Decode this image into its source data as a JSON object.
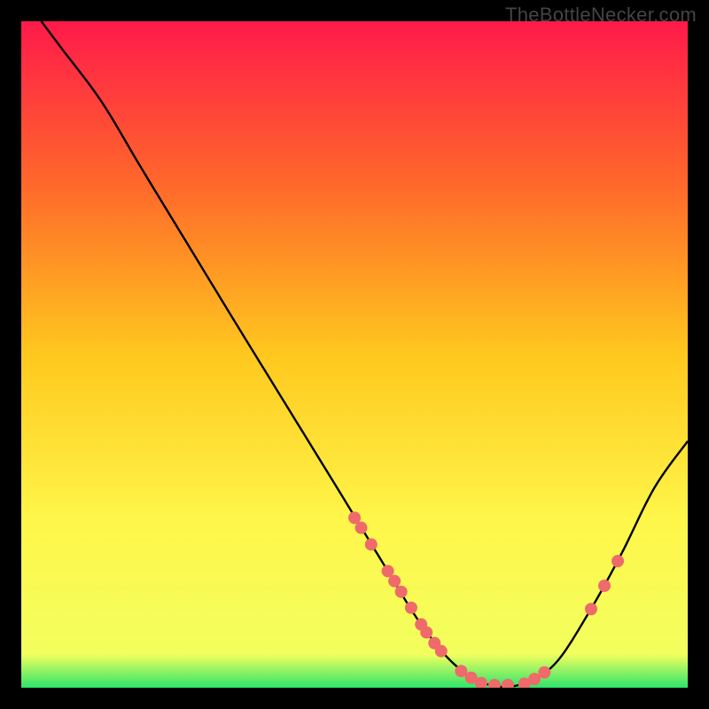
{
  "watermark": "TheBottleNecker.com",
  "chart_data": {
    "type": "line",
    "title": "",
    "xlabel": "",
    "ylabel": "",
    "xlim": [
      0,
      100
    ],
    "ylim": [
      0,
      100
    ],
    "grid": false,
    "background_gradient": {
      "stops": [
        {
          "offset": 0,
          "color": "#ff1a4a"
        },
        {
          "offset": 25,
          "color": "#ff6a2a"
        },
        {
          "offset": 50,
          "color": "#ffc81e"
        },
        {
          "offset": 75,
          "color": "#fff64a"
        },
        {
          "offset": 95,
          "color": "#f2ff5e"
        },
        {
          "offset": 100,
          "color": "#2ee56b"
        }
      ]
    },
    "curve": [
      {
        "x": 3.0,
        "y": 100.0
      },
      {
        "x": 6.0,
        "y": 96.0
      },
      {
        "x": 12.0,
        "y": 88.0
      },
      {
        "x": 18.0,
        "y": 78.0
      },
      {
        "x": 25.0,
        "y": 66.5
      },
      {
        "x": 32.0,
        "y": 55.0
      },
      {
        "x": 40.0,
        "y": 42.0
      },
      {
        "x": 48.0,
        "y": 29.0
      },
      {
        "x": 55.0,
        "y": 17.5
      },
      {
        "x": 60.0,
        "y": 9.5
      },
      {
        "x": 65.0,
        "y": 3.5
      },
      {
        "x": 70.0,
        "y": 0.5
      },
      {
        "x": 75.0,
        "y": 0.5
      },
      {
        "x": 80.0,
        "y": 3.5
      },
      {
        "x": 85.0,
        "y": 11.0
      },
      {
        "x": 90.0,
        "y": 20.0
      },
      {
        "x": 95.0,
        "y": 30.0
      },
      {
        "x": 100.0,
        "y": 37.0
      }
    ],
    "marker_points": [
      {
        "x": 50.0,
        "y": 25.5
      },
      {
        "x": 51.0,
        "y": 24.0
      },
      {
        "x": 52.5,
        "y": 21.5
      },
      {
        "x": 55.0,
        "y": 17.5
      },
      {
        "x": 56.0,
        "y": 16.0
      },
      {
        "x": 57.0,
        "y": 14.4
      },
      {
        "x": 58.5,
        "y": 12.0
      },
      {
        "x": 60.0,
        "y": 9.5
      },
      {
        "x": 60.8,
        "y": 8.3
      },
      {
        "x": 62.0,
        "y": 6.7
      },
      {
        "x": 63.0,
        "y": 5.5
      },
      {
        "x": 66.0,
        "y": 2.5
      },
      {
        "x": 67.5,
        "y": 1.5
      },
      {
        "x": 69.0,
        "y": 0.7
      },
      {
        "x": 71.0,
        "y": 0.4
      },
      {
        "x": 73.0,
        "y": 0.4
      },
      {
        "x": 75.5,
        "y": 0.6
      },
      {
        "x": 77.0,
        "y": 1.3
      },
      {
        "x": 78.5,
        "y": 2.3
      },
      {
        "x": 85.5,
        "y": 11.8
      },
      {
        "x": 87.5,
        "y": 15.3
      },
      {
        "x": 89.5,
        "y": 19.0
      }
    ],
    "marker_radius": 7,
    "marker_color": "#ef6a6a",
    "curve_color": "#000000",
    "curve_width": 2.4
  }
}
